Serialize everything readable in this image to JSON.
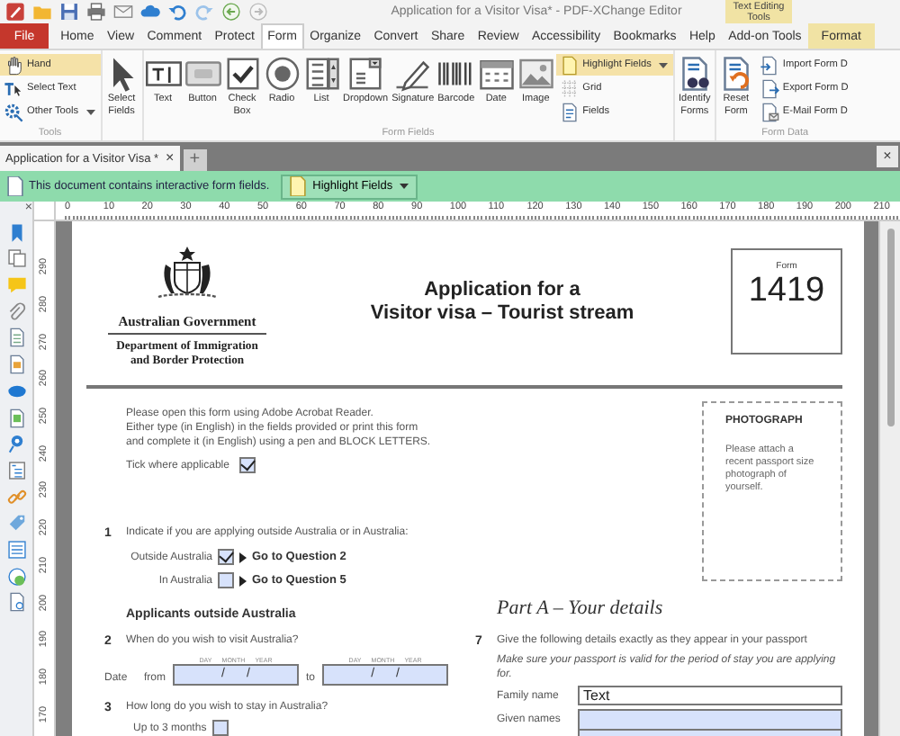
{
  "window": {
    "title": "Application for a Visitor Visa* - PDF-XChange Editor"
  },
  "context_group": {
    "label": "Text Editing Tools"
  },
  "menu_tabs": [
    {
      "label": "File",
      "kind": "file",
      "selected": false
    },
    {
      "label": "Home",
      "kind": "tab",
      "selected": false
    },
    {
      "label": "View",
      "kind": "tab",
      "selected": false
    },
    {
      "label": "Comment",
      "kind": "tab",
      "selected": false
    },
    {
      "label": "Protect",
      "kind": "tab",
      "selected": false
    },
    {
      "label": "Form",
      "kind": "tab",
      "selected": true
    },
    {
      "label": "Organize",
      "kind": "tab",
      "selected": false
    },
    {
      "label": "Convert",
      "kind": "tab",
      "selected": false
    },
    {
      "label": "Share",
      "kind": "tab",
      "selected": false
    },
    {
      "label": "Review",
      "kind": "tab",
      "selected": false
    },
    {
      "label": "Accessibility",
      "kind": "tab",
      "selected": false
    },
    {
      "label": "Bookmarks",
      "kind": "tab",
      "selected": false
    },
    {
      "label": "Help",
      "kind": "tab",
      "selected": false
    },
    {
      "label": "Add-on Tools",
      "kind": "tab",
      "selected": false
    },
    {
      "label": "Format",
      "kind": "context",
      "selected": false
    }
  ],
  "ribbon": [
    {
      "label": "Tools",
      "items": [
        {
          "kind": "small",
          "label": "Hand",
          "selected": true
        },
        {
          "kind": "small",
          "label": "Select Text",
          "selected": false
        },
        {
          "kind": "small",
          "label": "Other Tools",
          "selected": false,
          "dropdown": true
        }
      ]
    },
    {
      "items": [
        {
          "kind": "large",
          "label": "Select Fields",
          "selected": false
        }
      ]
    },
    {
      "label": "Form Fields",
      "items": [
        {
          "kind": "large",
          "label": "Text",
          "selected": false
        },
        {
          "kind": "large",
          "label": "Button",
          "selected": false
        },
        {
          "kind": "large",
          "label": "Check Box",
          "selected": false
        },
        {
          "kind": "large",
          "label": "Radio",
          "selected": false
        },
        {
          "kind": "large",
          "label": "List",
          "selected": false
        },
        {
          "kind": "large",
          "label": "Dropdown",
          "selected": false
        },
        {
          "kind": "large",
          "label": "Signature",
          "selected": false
        },
        {
          "kind": "large",
          "label": "Barcode",
          "selected": false
        },
        {
          "kind": "large",
          "label": "Date",
          "selected": false
        },
        {
          "kind": "large",
          "label": "Image",
          "selected": false
        },
        {
          "kind": "small",
          "label": "Highlight Fields",
          "selected": true,
          "dropdown": true
        },
        {
          "kind": "small",
          "label": "Grid",
          "selected": false
        },
        {
          "kind": "small",
          "label": "Fields",
          "selected": false
        }
      ]
    },
    {
      "items": [
        {
          "kind": "large",
          "label": "Identify Forms",
          "selected": false
        }
      ]
    },
    {
      "label": "Form Data",
      "items": [
        {
          "kind": "large",
          "label": "Reset Form",
          "selected": false
        },
        {
          "kind": "small",
          "label": "Import Form D",
          "selected": false
        },
        {
          "kind": "small",
          "label": "Export Form D",
          "selected": false
        },
        {
          "kind": "small",
          "label": "E-Mail Form D",
          "selected": false
        }
      ]
    }
  ],
  "doc_tabs": [
    {
      "label": "Application for a Visitor Visa *",
      "selected": true,
      "close": "×"
    }
  ],
  "new_tab": "+",
  "window_close": "×",
  "notice": {
    "text": "This document contains interactive form fields.",
    "button": "Highlight Fields"
  },
  "panel_close": "×",
  "ruler": {
    "x_labels": [
      "0",
      "10",
      "20",
      "30",
      "40",
      "50",
      "60",
      "70",
      "80",
      "90",
      "100",
      "110",
      "120",
      "130",
      "140",
      "150",
      "160",
      "170",
      "180",
      "190",
      "200",
      "210"
    ],
    "y_labels": [
      "290",
      "280",
      "270",
      "260",
      "250",
      "240",
      "230",
      "220",
      "210",
      "200",
      "190",
      "180",
      "170"
    ]
  },
  "page": {
    "agency": "Australian Government",
    "department": "Department of Immigration and Border Protection",
    "title_lines": [
      "Application for a",
      "Visitor visa – Tourist stream"
    ],
    "form_label": "Form",
    "form_number": "1419",
    "intro": [
      "Please open this form using Adobe Acrobat Reader.",
      "Either type (in English) in the fields provided or print this form and complete it (in English) using a pen and BLOCK LETTERS."
    ],
    "tick": {
      "label": "Tick where applicable",
      "checked": true
    },
    "photo": {
      "title": "PHOTOGRAPH",
      "text": "Please attach a recent passport size photograph of yourself."
    },
    "left": [
      {
        "kind": "question",
        "number": "1",
        "text": "Indicate if you are applying outside Australia or in Australia:"
      },
      {
        "kind": "goto",
        "label": "Outside Australia",
        "checked": true,
        "target": "Go to Question 2"
      },
      {
        "kind": "goto",
        "label": "In Australia",
        "checked": false,
        "target": "Go to Question 5"
      },
      {
        "kind": "heading",
        "text": "Applicants outside Australia"
      },
      {
        "kind": "question",
        "number": "2",
        "text": "When do you wish to visit Australia?"
      },
      {
        "kind": "dates",
        "label": "Date",
        "ranges": [
          {
            "prefix": "from",
            "parts": [
              "DAY",
              "MONTH",
              "YEAR"
            ],
            "separators": [
              "/",
              "/"
            ]
          },
          {
            "prefix": "to",
            "parts": [
              "DAY",
              "MONTH",
              "YEAR"
            ],
            "separators": [
              "/",
              "/"
            ]
          }
        ]
      },
      {
        "kind": "question",
        "number": "3",
        "text": "How long do you wish to stay in Australia?"
      },
      {
        "kind": "option",
        "label": "Up to 3 months",
        "checked": false
      }
    ],
    "part": {
      "title": "Part A – Your details",
      "number": "7",
      "text": "Give the following details exactly as they appear in your passport",
      "note": "Make sure your passport is valid for the period of stay you are applying for.",
      "fields": [
        {
          "label": "Family name",
          "value": "Text",
          "focused": true,
          "multiline": false
        },
        {
          "label": "Given names",
          "focused": false,
          "multiline": true
        }
      ]
    }
  }
}
